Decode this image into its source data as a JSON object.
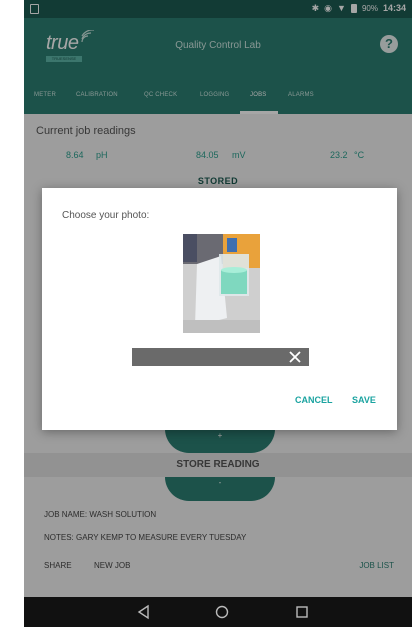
{
  "status_bar": {
    "time": "14:34",
    "battery": "90%",
    "icons": [
      "image-icon",
      "bluetooth-icon",
      "sync-icon",
      "wifi-icon",
      "signal-icon",
      "battery-icon"
    ]
  },
  "app_bar": {
    "logo_text": "true",
    "logo_subtext": "TRUESENSE",
    "title": "Quality Control Lab",
    "help_icon": "?"
  },
  "tabs": [
    {
      "label": "METER"
    },
    {
      "label": "CALIBRATION"
    },
    {
      "label": "QC CHECK"
    },
    {
      "label": "LOGGING"
    },
    {
      "label": "JOBS",
      "active": true
    },
    {
      "label": "ALARMS"
    }
  ],
  "readings": {
    "title": "Current job readings",
    "ph": "8.64",
    "ph_unit": "pH",
    "mv": "84.05",
    "mv_unit": "mV",
    "temp": "23.2",
    "temp_unit": "°C",
    "stored_label": "STORED"
  },
  "store_reading": {
    "plus_label": "+",
    "label": "STORE READING",
    "minus_label": "-"
  },
  "job": {
    "name": "JOB NAME: WASH SOLUTION",
    "notes": "NOTES: GARY KEMP TO MEASURE EVERY TUESDAY"
  },
  "actions": {
    "share": "SHARE",
    "new_job": "NEW JOB",
    "job_list": "JOB LIST"
  },
  "dialog": {
    "title": "Choose your photo:",
    "caption_value": "",
    "cancel": "CANCEL",
    "save": "SAVE"
  },
  "nav": {
    "back": "back-icon",
    "home": "home-icon",
    "recents": "recents-icon"
  },
  "colors": {
    "primary": "#2b7f72",
    "primary_dark": "#1d5b52",
    "accent": "#1aa3a0",
    "reading_text": "#2b9f8e"
  }
}
